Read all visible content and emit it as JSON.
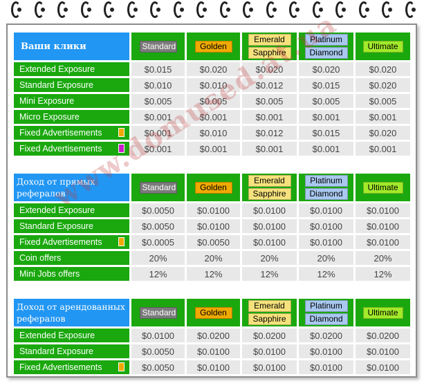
{
  "colors": {
    "header_blue": "#2196f3",
    "green": "#1aa80e",
    "value_bg": "#e8e8e8",
    "standard": "#7b7b7b",
    "golden": "#f0a900",
    "emerald": "#f6e27c",
    "platinum": "#a8c8ef",
    "ultimate": "#a2ea2a",
    "marker_orange": "#f0a900",
    "marker_magenta": "#c81ec8"
  },
  "membership": {
    "standard": "Standard",
    "golden": "Golden",
    "emerald": "Emerald",
    "sapphire": "Sapphire",
    "platinum": "Platinum",
    "diamond": "Diamond",
    "ultimate": "Ultimate"
  },
  "watermark": "www.domused.at.ua",
  "sections": [
    {
      "title": "Ваши клики",
      "rows": [
        {
          "label": "Extended Exposure",
          "marker": "",
          "values": [
            "$0.015",
            "$0.020",
            "$0.020",
            "$0.020",
            "$0.020"
          ]
        },
        {
          "label": "Standard Exposure",
          "marker": "",
          "values": [
            "$0.010",
            "$0.010",
            "$0.012",
            "$0.015",
            "$0.020"
          ]
        },
        {
          "label": "Mini Exposure",
          "marker": "",
          "values": [
            "$0.005",
            "$0.005",
            "$0.005",
            "$0.005",
            "$0.005"
          ]
        },
        {
          "label": "Micro Exposure",
          "marker": "",
          "values": [
            "$0.001",
            "$0.001",
            "$0.001",
            "$0.001",
            "$0.001"
          ]
        },
        {
          "label": "Fixed Advertisements",
          "marker": "orange",
          "values": [
            "$0.001",
            "$0.010",
            "$0.012",
            "$0.015",
            "$0.020"
          ]
        },
        {
          "label": "Fixed Advertisements",
          "marker": "magenta",
          "values": [
            "$0.001",
            "$0.001",
            "$0.001",
            "$0.001",
            "$0.001"
          ]
        }
      ]
    },
    {
      "title": "Доход от прямых рефералов",
      "rows": [
        {
          "label": "Extended Exposure",
          "marker": "",
          "values": [
            "$0.0050",
            "$0.0100",
            "$0.0100",
            "$0.0100",
            "$0.0100"
          ]
        },
        {
          "label": "Standard Exposure",
          "marker": "",
          "values": [
            "$0.0050",
            "$0.0100",
            "$0.0100",
            "$0.0100",
            "$0.0100"
          ]
        },
        {
          "label": "Fixed Advertisements",
          "marker": "orange",
          "values": [
            "$0.0005",
            "$0.0050",
            "$0.0100",
            "$0.0100",
            "$0.0100"
          ]
        },
        {
          "label": "Coin offers",
          "marker": "",
          "values": [
            "20%",
            "20%",
            "20%",
            "20%",
            "20%"
          ]
        },
        {
          "label": "Mini Jobs offers",
          "marker": "",
          "values": [
            "12%",
            "12%",
            "12%",
            "12%",
            "12%"
          ]
        }
      ]
    },
    {
      "title": "Доход от арендованных рефералов",
      "rows": [
        {
          "label": "Extended Exposure",
          "marker": "",
          "values": [
            "$0.0100",
            "$0.0200",
            "$0.0200",
            "$0.0200",
            "$0.0200"
          ]
        },
        {
          "label": "Standard Exposure",
          "marker": "",
          "values": [
            "$0.0050",
            "$0.0100",
            "$0.0100",
            "$0.0100",
            "$0.0100"
          ]
        },
        {
          "label": "Fixed Advertisements",
          "marker": "orange",
          "values": [
            "$0.0050",
            "$0.0100",
            "$0.0100",
            "$0.0100",
            "$0.0100"
          ]
        }
      ]
    }
  ]
}
